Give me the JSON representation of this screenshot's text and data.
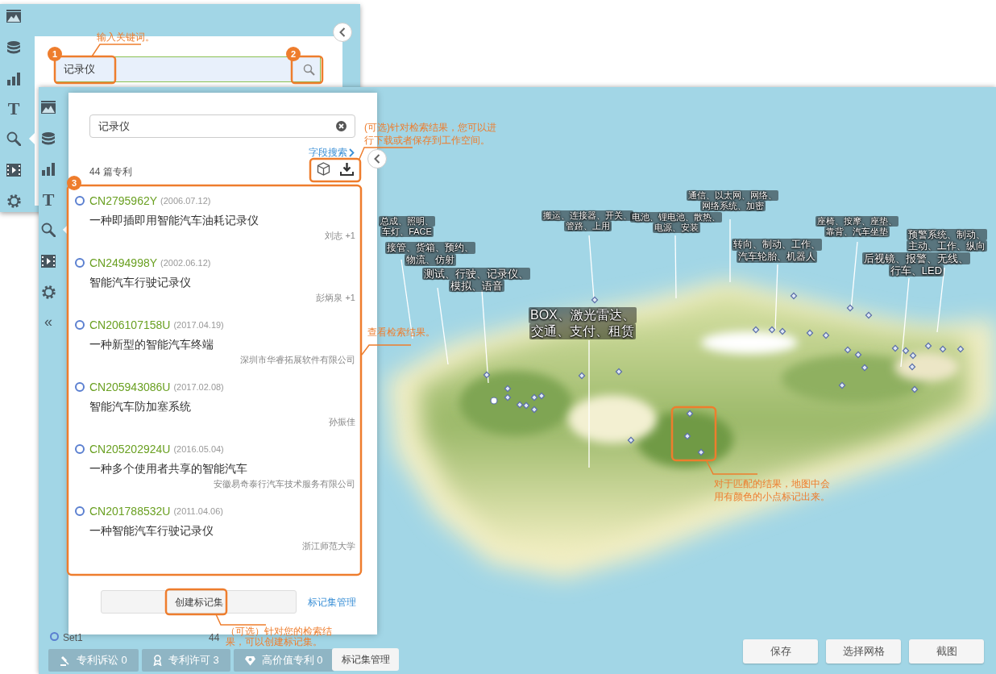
{
  "top_window": {
    "sidebar": [
      {
        "kind": "image",
        "selected": false
      },
      {
        "kind": "database",
        "selected": false
      },
      {
        "kind": "chart",
        "selected": false
      },
      {
        "kind": "text",
        "glyph": "T",
        "selected": false
      },
      {
        "kind": "search",
        "selected": true
      },
      {
        "kind": "video",
        "selected": false
      },
      {
        "kind": "settings",
        "selected": false
      }
    ],
    "search": {
      "value": "记录仪"
    }
  },
  "main_window": {
    "sidebar": [
      {
        "kind": "image",
        "selected": false
      },
      {
        "kind": "database",
        "selected": false
      },
      {
        "kind": "chart",
        "selected": false
      },
      {
        "kind": "text",
        "glyph": "T",
        "selected": false
      },
      {
        "kind": "search",
        "selected": true
      },
      {
        "kind": "video",
        "selected": false
      },
      {
        "kind": "settings",
        "selected": false
      },
      {
        "kind": "collapse",
        "glyph": "«",
        "selected": false
      }
    ],
    "results_panel": {
      "search_value": "记录仪",
      "field_search_link": "字段搜索",
      "count": "44 篇专利",
      "results": [
        {
          "number": "CN2795962Y",
          "date": "(2006.07.12)",
          "title": "一种即插即用智能汽车油耗记录仪",
          "owner": "刘志 +1"
        },
        {
          "number": "CN2494998Y",
          "date": "(2002.06.12)",
          "title": "智能汽车行驶记录仪",
          "owner": "彭炳泉 +1"
        },
        {
          "number": "CN206107158U",
          "date": "(2017.04.19)",
          "title": "一种新型的智能汽车终端",
          "owner": "深圳市华睿拓展软件有限公司"
        },
        {
          "number": "CN205943086U",
          "date": "(2017.02.08)",
          "title": "智能汽车防加塞系统",
          "owner": "孙振佳"
        },
        {
          "number": "CN205202924U",
          "date": "(2016.05.04)",
          "title": "一种多个使用者共享的智能汽车",
          "owner": "安徽易奇泰行汽车技术服务有限公司"
        },
        {
          "number": "CN201788532U",
          "date": "(2011.04.06)",
          "title": "一种智能汽车行驶记录仪",
          "owner": "浙江师范大学"
        }
      ],
      "create_button": "创建标记集",
      "manage_link": "标记集管理"
    },
    "marker_set": {
      "name": "Set1",
      "count": "44"
    },
    "stat_buttons": [
      {
        "kind": "gavel",
        "label": "专利诉讼 0"
      },
      {
        "kind": "ribbon",
        "label": "专利许可 3"
      },
      {
        "kind": "gem",
        "label": "高价值专利 0"
      }
    ],
    "manage_button": "标记集管理",
    "map": {
      "labels": [
        {
          "lines": [
            "总成、照明、",
            "车灯、FACE"
          ]
        },
        {
          "lines": [
            "接管、货箱、预约、",
            "物流、仿射"
          ]
        },
        {
          "lines": [
            "测试、行驶、记录仪、",
            "模拟、语音"
          ]
        },
        {
          "lines": [
            "搬运、连接器、开关、",
            "管路、上用"
          ]
        },
        {
          "lines": [
            "电池、锂电池、散热、",
            "电源、安装"
          ]
        },
        {
          "lines": [
            "通信、以太网、网络、",
            "网络系统、加密"
          ]
        },
        {
          "lines": [
            "转向、制动、工作、",
            "汽车轮胎、机器人"
          ]
        },
        {
          "lines": [
            "座椅、按摩、座垫、",
            "靠背、汽车坐垫"
          ]
        },
        {
          "lines": [
            "预警系统、制动、",
            "主动、工作、纵向"
          ]
        },
        {
          "lines": [
            "后视镜、报警、无线、",
            "行车、LED"
          ]
        },
        {
          "lines": [
            "BOX、激光雷达、",
            "交通、支付、租赁"
          ]
        }
      ],
      "buttons": [
        "保存",
        "选择网格",
        "截图"
      ]
    }
  },
  "annotations": [
    {
      "kind": "note",
      "text": "输入关键词。"
    },
    {
      "kind": "badge",
      "text": "1"
    },
    {
      "kind": "badge",
      "text": "2"
    },
    {
      "kind": "note",
      "text": "(可选)针对检索结果，您可以进行下载或者保存到工作空间。"
    },
    {
      "kind": "badge",
      "text": "3"
    },
    {
      "kind": "note",
      "text": "查看检索结果。"
    },
    {
      "kind": "note",
      "text": "（可选）针对您的检索结果，可以创建标记集。"
    },
    {
      "kind": "note",
      "text": "对于匹配的结果，地图中会用有颜色的小点标记出来。"
    }
  ]
}
